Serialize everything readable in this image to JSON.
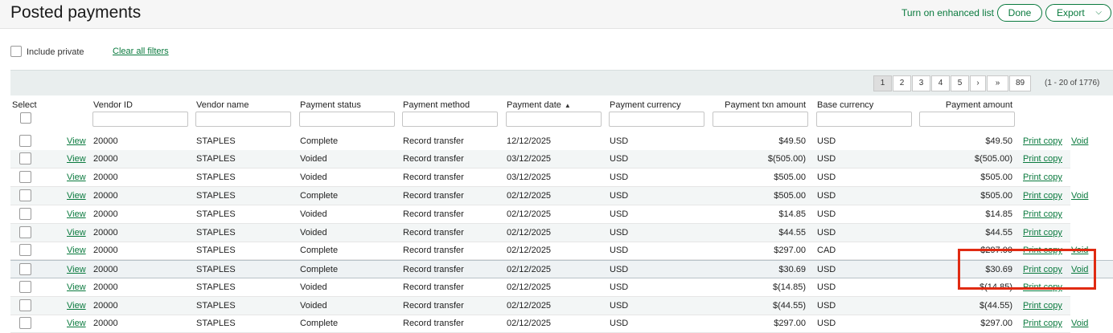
{
  "header": {
    "title": "Posted payments",
    "enhanced_link": "Turn on enhanced list",
    "done_label": "Done",
    "export_label": "Export",
    "export_chevron": "⌵"
  },
  "filters": {
    "include_private_label": "Include private",
    "include_private_checked": false,
    "clear_all_label": "Clear all filters"
  },
  "pagination": {
    "pages": [
      "1",
      "2",
      "3",
      "4",
      "5",
      "›",
      "»",
      "89"
    ],
    "active_page": "1",
    "range_text": "(1 - 20 of 1776)"
  },
  "columns": {
    "select": "Select",
    "vendor_id": "Vendor ID",
    "vendor_name": "Vendor name",
    "payment_status": "Payment status",
    "payment_method": "Payment method",
    "payment_date": "Payment date",
    "payment_currency": "Payment currency",
    "payment_txn_amount": "Payment txn amount",
    "base_currency": "Base currency",
    "payment_amount": "Payment amount",
    "sort_indicator": "▲"
  },
  "row_links": {
    "view": "View",
    "print": "Print copy",
    "void": "Void"
  },
  "rows": [
    {
      "vendor_id": "20000",
      "vendor_name": "STAPLES",
      "status": "Complete",
      "method": "Record transfer",
      "date": "12/12/2025",
      "currency": "USD",
      "txn_amount": "$49.50",
      "base_currency": "USD",
      "amount": "$49.50",
      "has_void": true
    },
    {
      "vendor_id": "20000",
      "vendor_name": "STAPLES",
      "status": "Voided",
      "method": "Record transfer",
      "date": "03/12/2025",
      "currency": "USD",
      "txn_amount": "$(505.00)",
      "base_currency": "USD",
      "amount": "$(505.00)",
      "has_void": false
    },
    {
      "vendor_id": "20000",
      "vendor_name": "STAPLES",
      "status": "Voided",
      "method": "Record transfer",
      "date": "03/12/2025",
      "currency": "USD",
      "txn_amount": "$505.00",
      "base_currency": "USD",
      "amount": "$505.00",
      "has_void": false
    },
    {
      "vendor_id": "20000",
      "vendor_name": "STAPLES",
      "status": "Complete",
      "method": "Record transfer",
      "date": "02/12/2025",
      "currency": "USD",
      "txn_amount": "$505.00",
      "base_currency": "USD",
      "amount": "$505.00",
      "has_void": true
    },
    {
      "vendor_id": "20000",
      "vendor_name": "STAPLES",
      "status": "Voided",
      "method": "Record transfer",
      "date": "02/12/2025",
      "currency": "USD",
      "txn_amount": "$14.85",
      "base_currency": "USD",
      "amount": "$14.85",
      "has_void": false
    },
    {
      "vendor_id": "20000",
      "vendor_name": "STAPLES",
      "status": "Voided",
      "method": "Record transfer",
      "date": "02/12/2025",
      "currency": "USD",
      "txn_amount": "$44.55",
      "base_currency": "USD",
      "amount": "$44.55",
      "has_void": false
    },
    {
      "vendor_id": "20000",
      "vendor_name": "STAPLES",
      "status": "Complete",
      "method": "Record transfer",
      "date": "02/12/2025",
      "currency": "USD",
      "txn_amount": "$297.00",
      "base_currency": "CAD",
      "amount": "$297.00",
      "has_void": true
    },
    {
      "vendor_id": "20000",
      "vendor_name": "STAPLES",
      "status": "Complete",
      "method": "Record transfer",
      "date": "02/12/2025",
      "currency": "USD",
      "txn_amount": "$30.69",
      "base_currency": "USD",
      "amount": "$30.69",
      "has_void": true
    },
    {
      "vendor_id": "20000",
      "vendor_name": "STAPLES",
      "status": "Voided",
      "method": "Record transfer",
      "date": "02/12/2025",
      "currency": "USD",
      "txn_amount": "$(14.85)",
      "base_currency": "USD",
      "amount": "$(14.85)",
      "has_void": false
    },
    {
      "vendor_id": "20000",
      "vendor_name": "STAPLES",
      "status": "Voided",
      "method": "Record transfer",
      "date": "02/12/2025",
      "currency": "USD",
      "txn_amount": "$(44.55)",
      "base_currency": "USD",
      "amount": "$(44.55)",
      "has_void": false
    },
    {
      "vendor_id": "20000",
      "vendor_name": "STAPLES",
      "status": "Complete",
      "method": "Record transfer",
      "date": "02/12/2025",
      "currency": "USD",
      "txn_amount": "$297.00",
      "base_currency": "USD",
      "amount": "$297.00",
      "has_void": true
    }
  ],
  "colors": {
    "accent": "#0a7a3e",
    "highlight": "#e02a12"
  }
}
